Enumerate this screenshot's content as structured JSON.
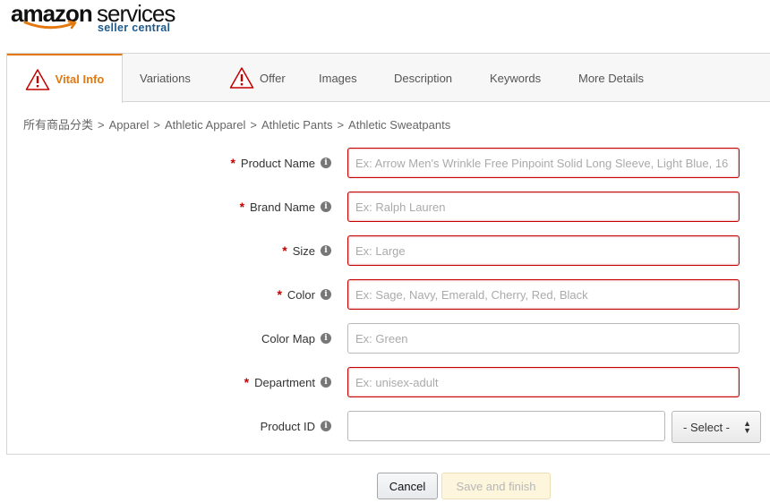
{
  "logo": {
    "brand": "amazon",
    "product": "services",
    "sub": "seller central"
  },
  "tabs": [
    {
      "label": "Vital Info",
      "warning": true,
      "active": true
    },
    {
      "label": "Variations",
      "warning": false,
      "active": false
    },
    {
      "label": "Offer",
      "warning": true,
      "active": false
    },
    {
      "label": "Images",
      "warning": false,
      "active": false
    },
    {
      "label": "Description",
      "warning": false,
      "active": false
    },
    {
      "label": "Keywords",
      "warning": false,
      "active": false
    },
    {
      "label": "More Details",
      "warning": false,
      "active": false
    }
  ],
  "breadcrumb": [
    "所有商品分类",
    "Apparel",
    "Athletic Apparel",
    "Athletic Pants",
    "Athletic Sweatpants"
  ],
  "breadcrumb_sep": ">",
  "fields": [
    {
      "label": "Product Name",
      "required": true,
      "placeholder": "Ex: Arrow Men's Wrinkle Free Pinpoint Solid Long Sleeve, Light Blue, 16",
      "value": ""
    },
    {
      "label": "Brand Name",
      "required": true,
      "placeholder": "Ex: Ralph Lauren",
      "value": ""
    },
    {
      "label": "Size",
      "required": true,
      "placeholder": "Ex: Large",
      "value": ""
    },
    {
      "label": "Color",
      "required": true,
      "placeholder": "Ex: Sage, Navy, Emerald, Cherry, Red, Black",
      "value": ""
    },
    {
      "label": "Color Map",
      "required": false,
      "placeholder": "Ex: Green",
      "value": ""
    },
    {
      "label": "Department",
      "required": true,
      "placeholder": "Ex: unisex-adult",
      "value": ""
    },
    {
      "label": "Product ID",
      "required": false,
      "placeholder": "",
      "value": ""
    }
  ],
  "product_id_select": {
    "selected": "- Select -"
  },
  "required_marker": "*",
  "info_glyph": "i",
  "buttons": {
    "cancel": "Cancel",
    "save": "Save and finish"
  },
  "colors": {
    "accent": "#e47911",
    "error": "#c40000",
    "brand_blue": "#1e5a8c"
  },
  "icons": {
    "warning": "warning-triangle-icon",
    "info": "info-icon",
    "select_arrows": "updown-arrows-icon",
    "logo_smile": "amazon-smile-icon"
  }
}
